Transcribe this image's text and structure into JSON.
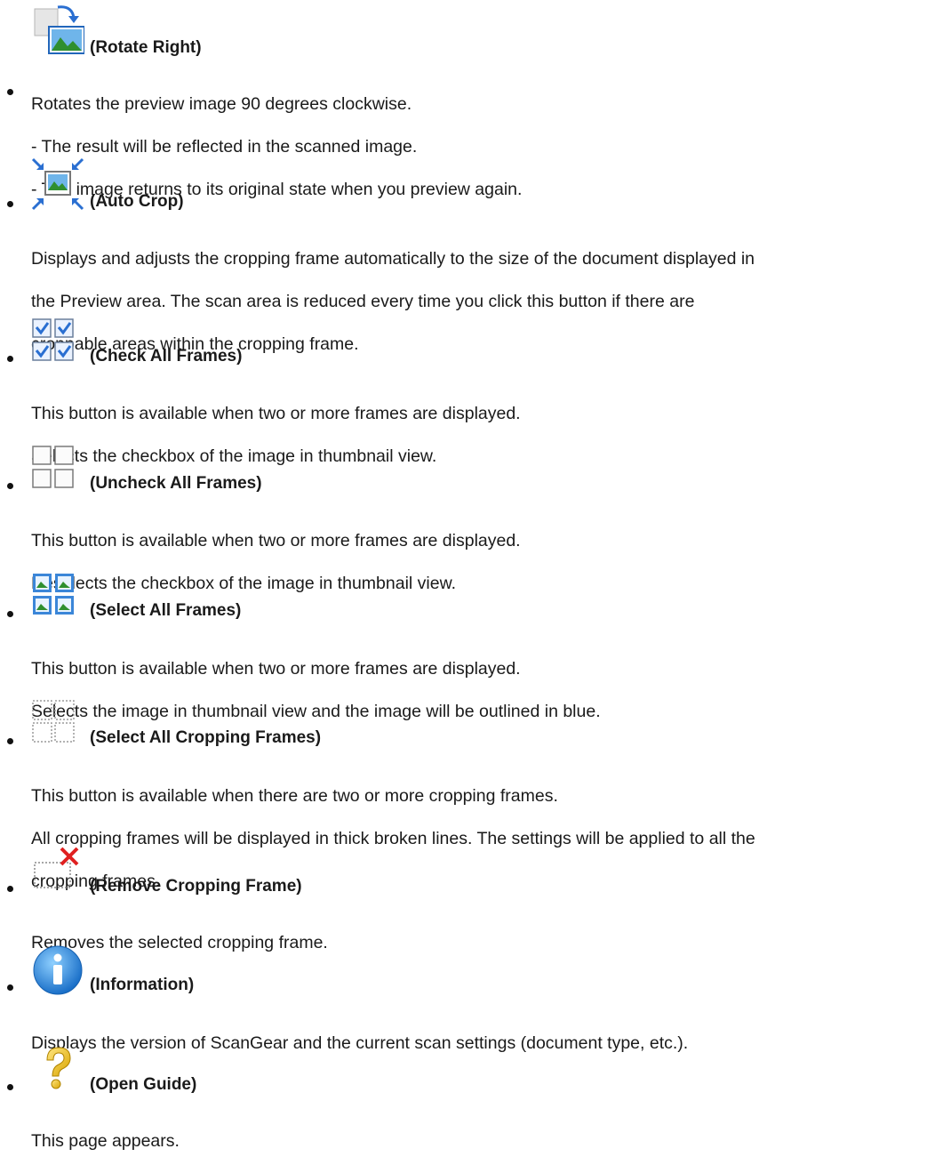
{
  "items": [
    {
      "title": "(Rotate Right)",
      "icon": "rotate-right-icon",
      "lines": [
        "Rotates the preview image 90 degrees clockwise.",
        "- The result will be reflected in the scanned image.",
        "- The image returns to its original state when you preview again."
      ]
    },
    {
      "title": "(Auto Crop)",
      "icon": "auto-crop-icon",
      "lines": [
        "Displays and adjusts the cropping frame automatically to the size of the document displayed in",
        "the Preview area. The scan area is reduced every time you click this button if there are",
        "croppable areas within the cropping frame."
      ]
    },
    {
      "title": "(Check All Frames)",
      "icon": "check-all-frames-icon",
      "lines": [
        "This button is available when two or more frames are displayed.",
        "Selects the checkbox of the image in thumbnail view."
      ]
    },
    {
      "title": "(Uncheck All Frames)",
      "icon": "uncheck-all-frames-icon",
      "lines": [
        "This button is available when two or more frames are displayed.",
        "Deselects the checkbox of the image in thumbnail view."
      ]
    },
    {
      "title": "(Select All Frames)",
      "icon": "select-all-frames-icon",
      "lines": [
        "This button is available when two or more frames are displayed.",
        "Selects the image in thumbnail view and the image will be outlined in blue."
      ]
    },
    {
      "title": "(Select All Cropping Frames)",
      "icon": "select-all-cropping-frames-icon",
      "lines": [
        "This button is available when there are two or more cropping frames.",
        "All cropping frames will be displayed in thick broken lines. The settings will be applied to all the",
        "cropping frames."
      ]
    },
    {
      "title": "(Remove Cropping Frame)",
      "icon": "remove-cropping-frame-icon",
      "lines": [
        "Removes the selected cropping frame."
      ]
    },
    {
      "title": "(Information)",
      "icon": "information-icon",
      "lines": [
        "Displays the version of ScanGear and the current scan settings (document type, etc.)."
      ]
    },
    {
      "title": "(Open Guide)",
      "icon": "open-guide-icon",
      "lines": [
        "This page appears."
      ]
    }
  ]
}
